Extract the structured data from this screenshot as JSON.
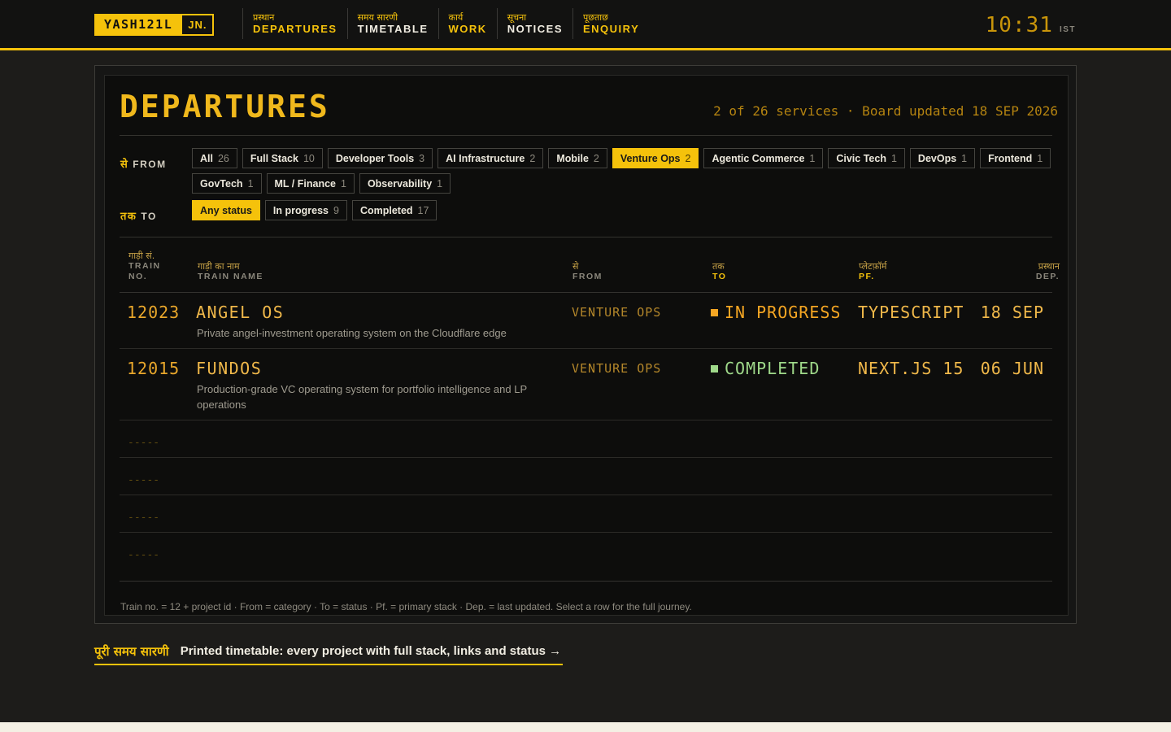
{
  "header": {
    "logo_main": "YASH121L",
    "logo_suffix": "JN.",
    "nav": [
      {
        "hi": "प्रस्थान",
        "en": "DEPARTURES"
      },
      {
        "hi": "समय सारणी",
        "en": "TIMETABLE"
      },
      {
        "hi": "कार्य",
        "en": "WORK"
      },
      {
        "hi": "सूचना",
        "en": "NOTICES"
      },
      {
        "hi": "पूछताछ",
        "en": "ENQUIRY"
      }
    ],
    "clock": "10:31",
    "zone": "IST"
  },
  "board": {
    "title": "DEPARTURES",
    "meta": "2 of 26 services · Board updated 18 SEP 2026",
    "from_label_hi": "से",
    "from_label_en": "FROM",
    "to_label_hi": "तक",
    "to_label_en": "TO",
    "categories": [
      {
        "label": "All",
        "count": "26"
      },
      {
        "label": "Full Stack",
        "count": "10"
      },
      {
        "label": "Developer Tools",
        "count": "3"
      },
      {
        "label": "AI Infrastructure",
        "count": "2"
      },
      {
        "label": "Mobile",
        "count": "2"
      },
      {
        "label": "Venture Ops",
        "count": "2",
        "active": true
      },
      {
        "label": "Agentic Commerce",
        "count": "1"
      },
      {
        "label": "Civic Tech",
        "count": "1"
      },
      {
        "label": "DevOps",
        "count": "1"
      },
      {
        "label": "Frontend",
        "count": "1"
      },
      {
        "label": "GovTech",
        "count": "1"
      },
      {
        "label": "ML / Finance",
        "count": "1"
      },
      {
        "label": "Observability",
        "count": "1"
      }
    ],
    "statuses": [
      {
        "label": "Any status",
        "count": "",
        "active": true
      },
      {
        "label": "In progress",
        "count": "9"
      },
      {
        "label": "Completed",
        "count": "17"
      }
    ],
    "columns": {
      "train_no_hi": "गाड़ी सं.",
      "train_no_en_1": "TRAIN",
      "train_no_en_2": "NO.",
      "name_hi": "गाड़ी का नाम",
      "name_en": "TRAIN NAME",
      "from_hi": "से",
      "from_en": "FROM",
      "to_hi": "तक",
      "to_en": "TO",
      "pf_hi": "प्लेटफ़ॉर्म",
      "pf_en": "PF.",
      "dep_hi": "प्रस्थान",
      "dep_en": "DEP."
    },
    "rows": [
      {
        "no": "12023",
        "name": "ANGEL OS",
        "desc": "Private angel-investment operating system on the Cloudflare edge",
        "from": "VENTURE OPS",
        "to": "IN PROGRESS",
        "to_color": "#f5a623",
        "pf": "TYPESCRIPT",
        "dep": "18 SEP"
      },
      {
        "no": "12015",
        "name": "FUNDOS",
        "desc": "Production-grade VC operating system for portfolio intelligence and LP operations",
        "from": "VENTURE OPS",
        "to": "COMPLETED",
        "to_color": "#9fd98a",
        "pf": "NEXT.JS 15",
        "dep": "06 JUN"
      }
    ],
    "empty_rows": [
      "-----",
      "-----",
      "-----",
      "-----"
    ],
    "legend": "Train no. = 12 + project id · From = category · To = status · Pf. = primary stack · Dep. = last updated. Select a row for the full journey."
  },
  "timetable_link": {
    "hi": "पूरी समय सारणी",
    "en": "Printed timetable: every project with full stack, links and status →"
  },
  "colors": {
    "accent": "#f5c20b",
    "in_progress": "#f5a623",
    "completed": "#9fd98a"
  }
}
